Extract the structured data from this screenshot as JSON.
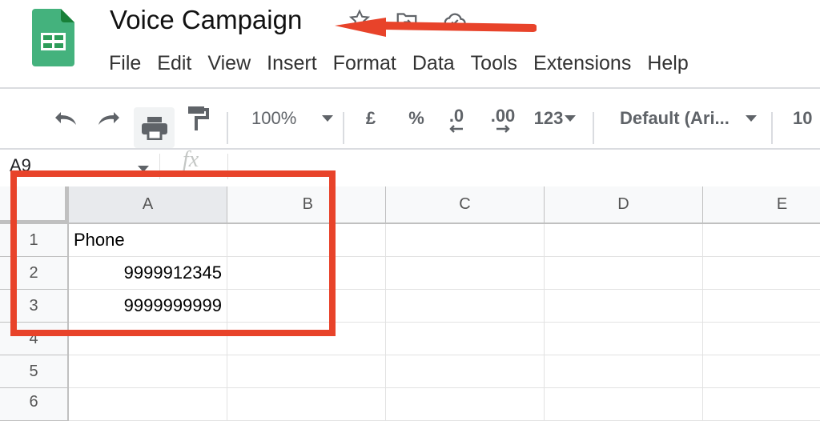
{
  "app": {
    "document_title": "Voice Campaign",
    "header_icons": [
      "star-icon",
      "move-to-folder-icon",
      "cloud-saved-icon"
    ]
  },
  "menubar": {
    "items": [
      "File",
      "Edit",
      "View",
      "Insert",
      "Format",
      "Data",
      "Tools",
      "Extensions",
      "Help"
    ]
  },
  "toolbar": {
    "undo": "undo-icon",
    "redo": "redo-icon",
    "print": "print-icon",
    "paint_format": "paint-format-icon",
    "zoom_value": "100%",
    "currency": "£",
    "percent": "%",
    "decrease_decimal": ".0",
    "increase_decimal": ".00",
    "more_formats": "123",
    "font_name": "Default (Ari...",
    "font_size": "10"
  },
  "formula_bar": {
    "name_box": "A9",
    "fx_label": "fx",
    "value": ""
  },
  "grid": {
    "columns": [
      "A",
      "B",
      "C",
      "D",
      "E"
    ],
    "rows": [
      "1",
      "2",
      "3",
      "4",
      "5",
      "6"
    ],
    "cells": {
      "A1": "Phone",
      "A2": "9999912345",
      "A3": "9999999999"
    }
  },
  "annotations": {
    "color": "#e8432a",
    "arrow_target": "document title",
    "box_target": "columns A-B rows 1-3"
  }
}
